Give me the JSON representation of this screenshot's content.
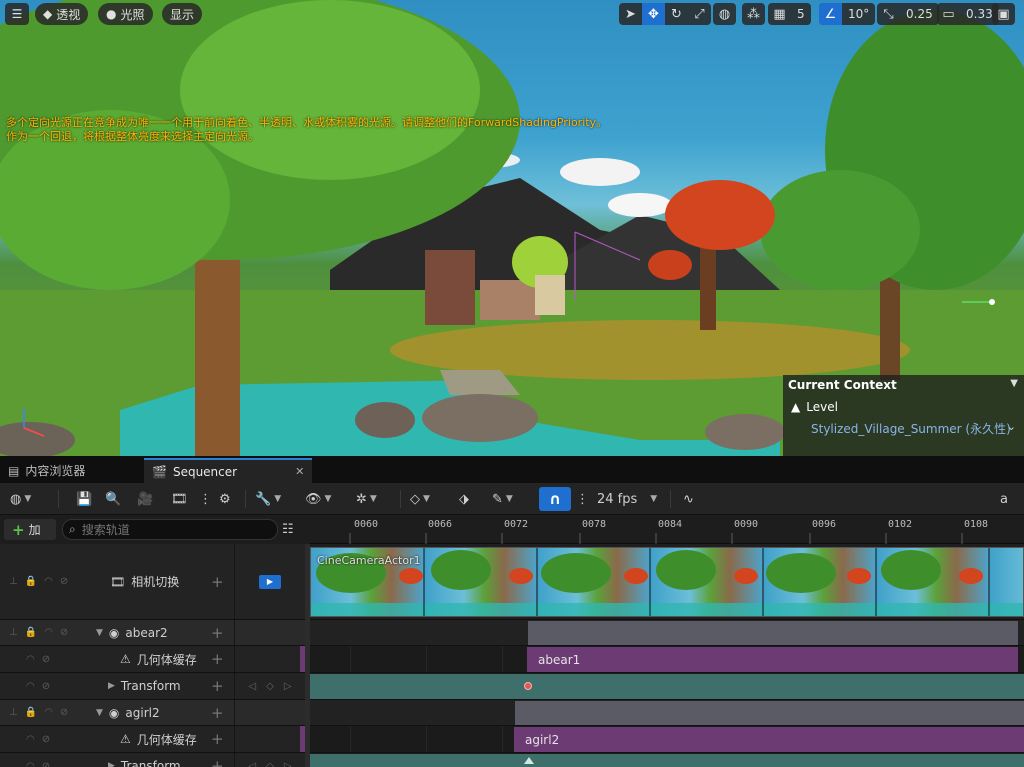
{
  "viewport": {
    "menu_icon": "hamburger-icon",
    "perspective_label": "透视",
    "lit_label": "光照",
    "show_label": "显示",
    "grid_snap_value": "5",
    "rotation_snap_value": "10°",
    "scale_snap_value": "0.25",
    "camera_speed_value": "0.33",
    "warning_line1": "多个定向光源正在竞争成为唯一一个用于前向着色、半透明、水或体积雾的光源。请调整他们的ForwardShadingPriority。",
    "warning_line2": "作为一个回退，将根据整体亮度来选择主定向光源。",
    "context_title": "Current Context",
    "context_level": "Level",
    "context_map": "Stylized_Village_Summer (永久性)"
  },
  "tabs": [
    {
      "label": "内容浏览器",
      "icon": "content-browser-icon"
    },
    {
      "label": "Sequencer",
      "icon": "clapperboard-icon"
    }
  ],
  "toolbar": {
    "fps_label": "24 fps",
    "right_letter": "a"
  },
  "sidebar": {
    "add_label": "加",
    "search_placeholder": "搜索轨道"
  },
  "ruler": {
    "ticks": [
      "0060",
      "0066",
      "0072",
      "0078",
      "0084",
      "0090",
      "0096",
      "0102",
      "0108"
    ]
  },
  "tracks": [
    {
      "label": "相机切换",
      "kind": "camera-cut"
    },
    {
      "label": "abear2",
      "kind": "actor"
    },
    {
      "label": "几何体缓存",
      "kind": "geometry-cache"
    },
    {
      "label": "Transform",
      "kind": "transform"
    },
    {
      "label": "agirl2",
      "kind": "actor"
    },
    {
      "label": "几何体缓存",
      "kind": "geometry-cache"
    },
    {
      "label": "Transform",
      "kind": "transform"
    }
  ],
  "sections": {
    "camera_cut": "CineCameraActor1",
    "abear_cache": "abear1",
    "agirl_cache": "agirl2"
  },
  "colors": {
    "accent_blue": "#1f6fd1",
    "warning_orange": "#ffb400",
    "section_purple": "#6c3b73",
    "transform_teal": "#3f6f6a",
    "actor_gray": "#5b5b66"
  }
}
